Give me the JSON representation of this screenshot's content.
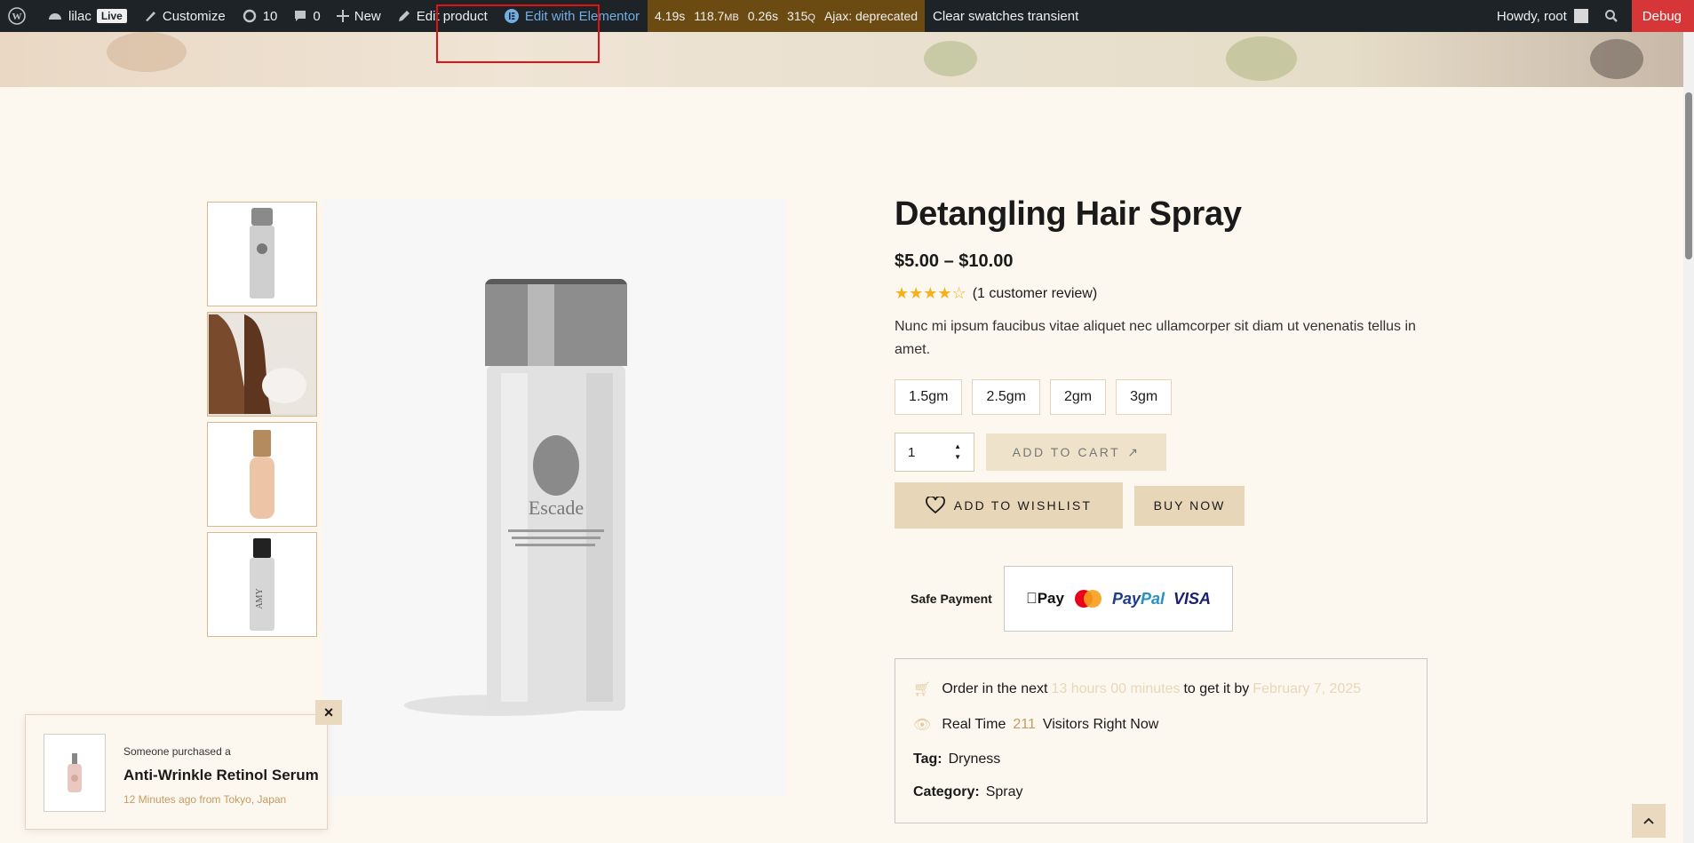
{
  "adminbar": {
    "site_name": "lilac",
    "live_badge": "Live",
    "customize": "Customize",
    "updates_count": "10",
    "comments_count": "0",
    "new": "New",
    "edit_product": "Edit product",
    "edit_elementor": "Edit with Elementor",
    "qm_time": "4.19s",
    "qm_mem": "118.7",
    "qm_mem_unit": "MB",
    "qm_db_time": "0.26s",
    "qm_queries": "315",
    "qm_queries_unit": "Q",
    "qm_ajax": "Ajax: deprecated",
    "clear_swatches": "Clear swatches transient",
    "howdy": "Howdy, root",
    "debug": "Debug"
  },
  "gallery": {
    "thumbs": [
      "thumb-silver-bottle",
      "thumb-woman-hair",
      "thumb-gold-bottle",
      "thumb-black-cap-bottle"
    ],
    "main_brand": "Escade"
  },
  "product": {
    "title": "Detangling Hair Spray",
    "price": "$5.00 – $10.00",
    "rating_value": 4,
    "rating_max": 5,
    "review_text": "(1 customer review)",
    "description": "Nunc mi ipsum faucibus vitae aliquet nec ullamcorper sit diam ut venenatis tellus in amet.",
    "variations": [
      "1.5gm",
      "2.5gm",
      "2gm",
      "3gm"
    ],
    "quantity": "1",
    "add_to_cart": "ADD TO CART",
    "add_to_wishlist": "ADD TO WISHLIST",
    "buy_now": "BUY NOW",
    "safe_payment": "Safe Payment",
    "payments": {
      "apple": "Pay",
      "paypal_a": "Pay",
      "paypal_b": "Pal",
      "visa": "VISA"
    },
    "delivery": {
      "prefix": "Order in the next",
      "countdown": "13 hours 00 minutes",
      "middle": "to get it by",
      "date": "February 7, 2025"
    },
    "visitors": {
      "prefix": "Real Time",
      "count": "211",
      "suffix": "Visitors Right Now"
    },
    "tag_label": "Tag:",
    "tag_value": "Dryness",
    "category_label": "Category:",
    "category_value": "Spray"
  },
  "notification": {
    "subtitle": "Someone purchased a",
    "title": "Anti-Wrinkle Retinol Serum",
    "time": "12 Minutes ago from Tokyo, Japan",
    "close": "×"
  },
  "backtop_icon": "chevron-up-icon",
  "colors": {
    "page_bg": "#fcf7ef",
    "adminbar": "#1d2327",
    "debug": "#d63638",
    "accent": "#e8d6b8",
    "star": "#f3b21c",
    "highlight": "#e21212"
  }
}
